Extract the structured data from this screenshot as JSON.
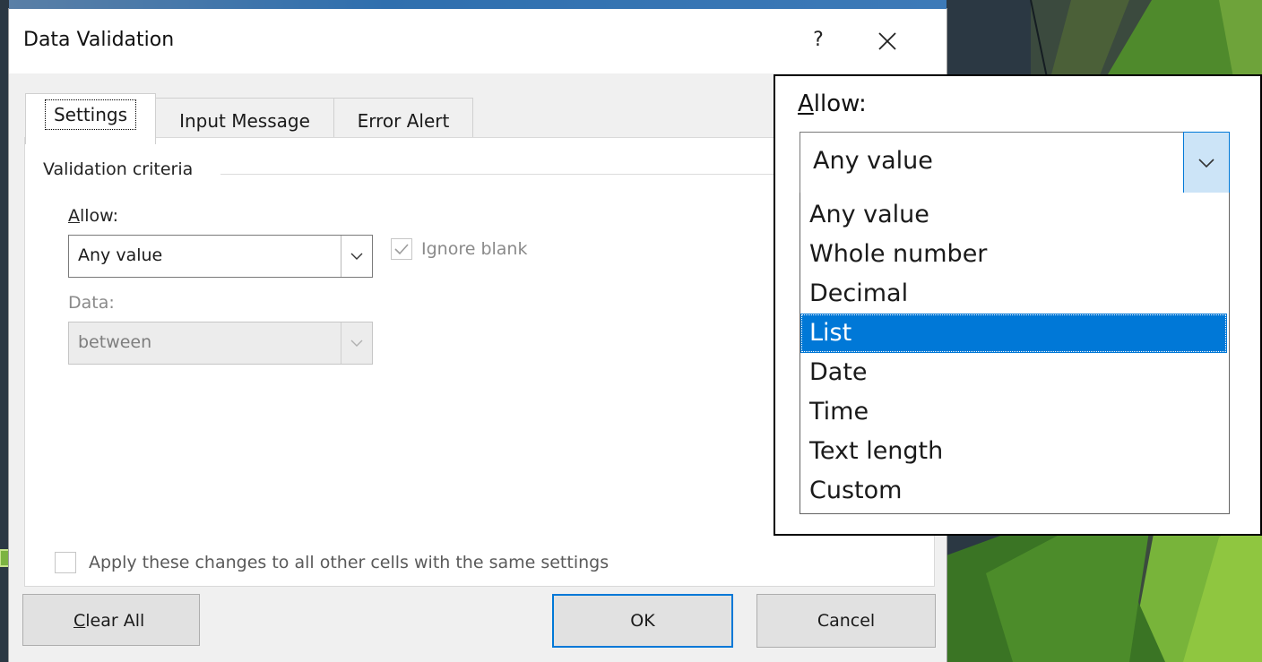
{
  "dialog": {
    "title": "Data Validation",
    "help_label": "?",
    "tabs": [
      {
        "label": "Settings",
        "active": true
      },
      {
        "label": "Input Message",
        "active": false
      },
      {
        "label": "Error Alert",
        "active": false
      }
    ],
    "settings": {
      "group_label": "Validation criteria",
      "allow_label_accel": "A",
      "allow_label_rest": "llow:",
      "allow_value": "Any value",
      "ignore_blank_label": "Ignore blank",
      "ignore_blank_checked": true,
      "data_label": "Data:",
      "data_value": "between",
      "apply_all_label": "Apply these changes to all other cells with the same settings",
      "apply_all_checked": false
    },
    "buttons": {
      "clear_all_accel": "C",
      "clear_all_rest": "lear All",
      "ok": "OK",
      "cancel": "Cancel"
    }
  },
  "callout": {
    "allow_label_accel": "A",
    "allow_label_rest": "llow:",
    "selected_value": "Any value",
    "options": [
      "Any value",
      "Whole number",
      "Decimal",
      "List",
      "Date",
      "Time",
      "Text length",
      "Custom"
    ],
    "highlighted_option": "List"
  },
  "colors": {
    "accent": "#0078d7",
    "selection": "#0078d7",
    "dropdown_arrow_bg": "#cce4f7",
    "background_dark": "#2d3a44",
    "background_green": "#4e8a2b",
    "arrow_green": "#7cb342"
  }
}
